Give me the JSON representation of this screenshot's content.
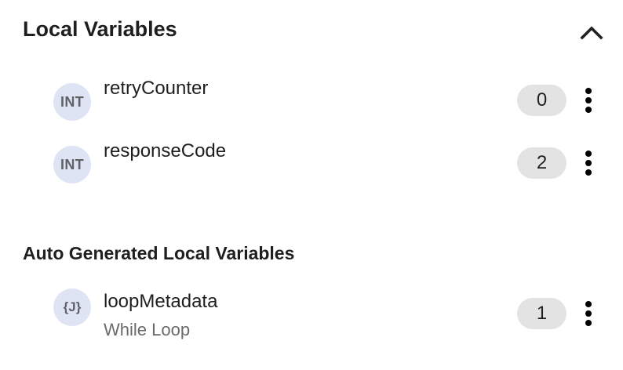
{
  "local_variables": {
    "title": "Local Variables",
    "collapse_icon": "chevron-up-icon",
    "items": [
      {
        "type": "INT",
        "name": "retryCounter",
        "count": "0",
        "menu_icon": "more-vert-icon"
      },
      {
        "type": "INT",
        "name": "responseCode",
        "count": "2",
        "menu_icon": "more-vert-icon"
      }
    ]
  },
  "auto_generated": {
    "title": "Auto Generated Local Variables",
    "items": [
      {
        "type": "{J}",
        "name": "loopMetadata",
        "subtitle": "While Loop",
        "count": "1",
        "menu_icon": "more-vert-icon"
      }
    ]
  },
  "colors": {
    "badge_bg": "#dfe4f5",
    "badge_text": "#5f6368",
    "pill_bg": "#e3e3e3",
    "subtitle": "#6b6b6b"
  }
}
